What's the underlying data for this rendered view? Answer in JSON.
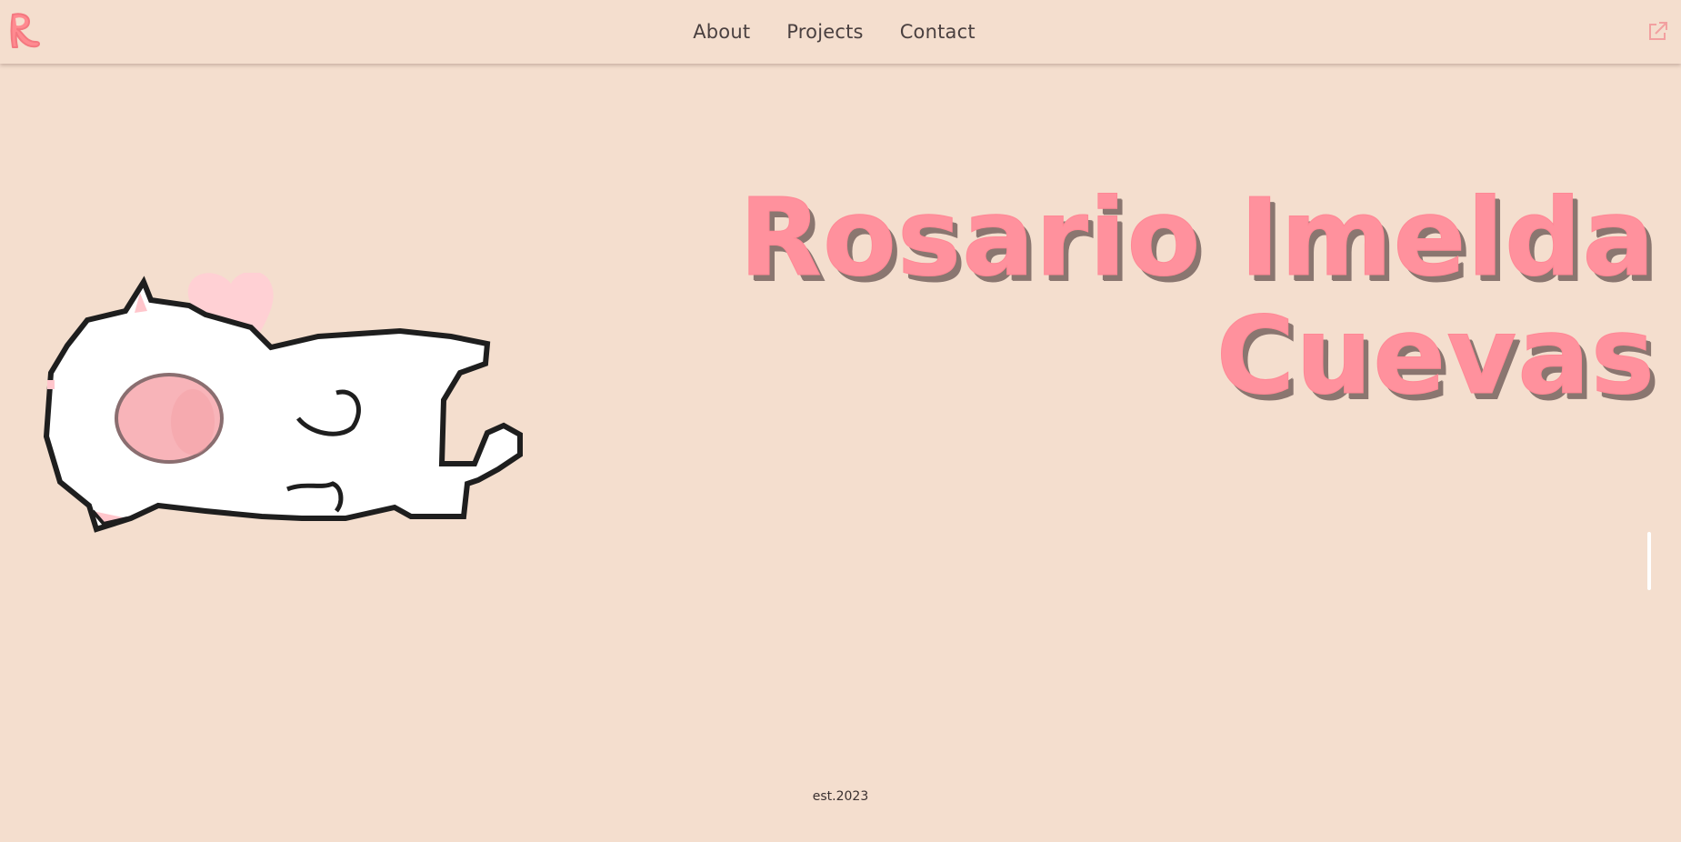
{
  "header": {
    "logo_icon": "r-monogram-logo-icon",
    "nav_links": [
      "About",
      "Projects",
      "Contact"
    ],
    "external_icon": "external-link-icon"
  },
  "hero": {
    "title_line1": "Rosario Imelda",
    "title_line2": "Cuevas",
    "illustration": "pixel-cat-with-heart-icon"
  },
  "footer": {
    "text": "est.2023"
  },
  "colors": {
    "background": "#f4dece",
    "accent_pink": "#ff919d",
    "title_shadow": "#8a7670",
    "nav_text": "#4a4040"
  }
}
